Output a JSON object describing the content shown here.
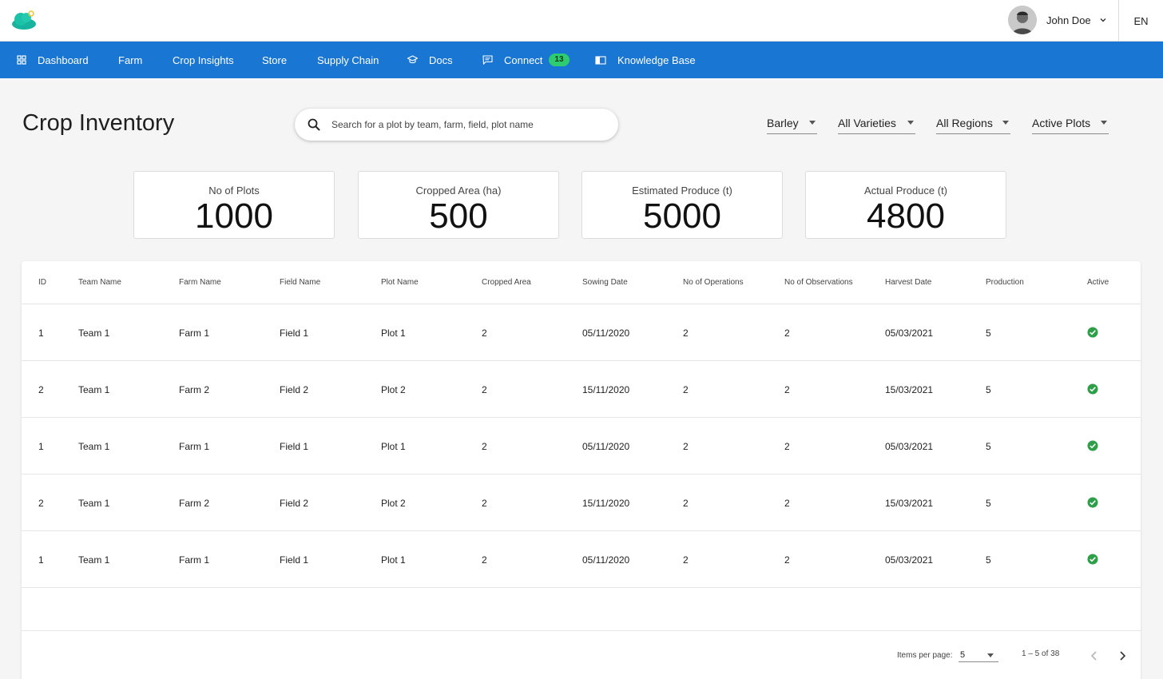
{
  "user": {
    "name": "John Doe"
  },
  "language": "EN",
  "nav": [
    {
      "label": "Dashboard",
      "icon": "grid-icon"
    },
    {
      "label": "Farm"
    },
    {
      "label": "Crop Insights"
    },
    {
      "label": "Store"
    },
    {
      "label": "Supply Chain"
    },
    {
      "label": "Docs",
      "icon": "graduation-cap-icon"
    },
    {
      "label": "Connect",
      "icon": "chat-icon",
      "badge": "13"
    },
    {
      "label": "Knowledge Base",
      "icon": "book-icon"
    }
  ],
  "page": {
    "title": "Crop Inventory"
  },
  "search": {
    "placeholder": "Search for a plot by team, farm, field, plot name"
  },
  "filters": {
    "crop": "Barley",
    "variety": "All Varieties",
    "region": "All Regions",
    "status": "Active Plots"
  },
  "stats": [
    {
      "label": "No of Plots",
      "value": "1000"
    },
    {
      "label": "Cropped Area (ha)",
      "value": "500"
    },
    {
      "label": "Estimated Produce (t)",
      "value": "5000"
    },
    {
      "label": "Actual Produce (t)",
      "value": "4800"
    }
  ],
  "table": {
    "columns": [
      "ID",
      "Team Name",
      "Farm Name",
      "Field Name",
      "Plot Name",
      "Cropped Area",
      "Sowing Date",
      "No of Operations",
      "No of Observations",
      "Harvest Date",
      "Production",
      "Active"
    ],
    "rows": [
      [
        "1",
        "Team 1",
        "Farm 1",
        "Field 1",
        "Plot 1",
        "2",
        "05/11/2020",
        "2",
        "2",
        "05/03/2021",
        "5"
      ],
      [
        "2",
        "Team 1",
        "Farm 2",
        "Field 2",
        "Plot 2",
        "2",
        "15/11/2020",
        "2",
        "2",
        "15/03/2021",
        "5"
      ],
      [
        "1",
        "Team 1",
        "Farm 1",
        "Field 1",
        "Plot 1",
        "2",
        "05/11/2020",
        "2",
        "2",
        "05/03/2021",
        "5"
      ],
      [
        "2",
        "Team 1",
        "Farm 2",
        "Field 2",
        "Plot 2",
        "2",
        "15/11/2020",
        "2",
        "2",
        "15/03/2021",
        "5"
      ],
      [
        "1",
        "Team 1",
        "Farm 1",
        "Field 1",
        "Plot 1",
        "2",
        "05/11/2020",
        "2",
        "2",
        "05/03/2021",
        "5"
      ]
    ],
    "active_color": "#2e9e48"
  },
  "paginator": {
    "items_per_page_label": "Items per page:",
    "items_per_page": "5",
    "range": "1 – 5 of 38"
  },
  "colors": {
    "nav": "#1976d2",
    "badge": "#2ecc71",
    "logo": "#17b7a0"
  }
}
